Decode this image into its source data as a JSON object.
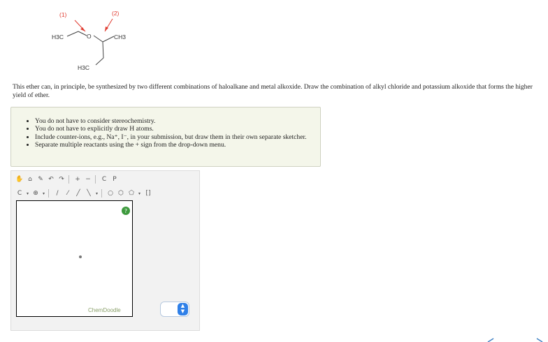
{
  "molecule": {
    "labels": {
      "left_methyl": "H3C",
      "oxygen": "O",
      "right_methyl": "CH3",
      "bottom_methyl": "H3C"
    },
    "arrow_labels": [
      "(1)",
      "(2)"
    ],
    "arrow_color": "#e03a2f"
  },
  "question": {
    "text": "This ether can, in principle, be synthesized by two different combinations of haloalkane and metal alkoxide. Draw the combination of alkyl chloride and potassium alkoxide that forms the higher yield of ether."
  },
  "notes": [
    "You do not have to consider stereochemistry.",
    "You do not have to explicitly draw H atoms.",
    "Include counter-ions, e.g., Na⁺, I⁻, in your submission, but draw them in their own separate sketcher.",
    "Separate multiple reactants using the + sign from the drop-down menu."
  ],
  "toolbar": {
    "row1": [
      {
        "name": "clear-icon",
        "glyph": "✋"
      },
      {
        "name": "erase-icon",
        "glyph": "⌂"
      },
      {
        "name": "pen-icon",
        "glyph": "✎"
      },
      {
        "name": "undo-icon",
        "glyph": "↶"
      },
      {
        "name": "redo-icon",
        "glyph": "↷"
      },
      {
        "name": "zoom-in-icon",
        "glyph": "+"
      },
      {
        "name": "zoom-out-icon",
        "glyph": "−"
      },
      {
        "name": "clean-icon",
        "glyph": "C"
      },
      {
        "name": "template-icon",
        "glyph": "P"
      }
    ],
    "row2": [
      {
        "name": "element-c-icon",
        "glyph": "C"
      },
      {
        "name": "charge-icon",
        "glyph": "⊕"
      },
      {
        "name": "single-bond-icon",
        "glyph": "/"
      },
      {
        "name": "double-bond-icon",
        "glyph": "⁄"
      },
      {
        "name": "wedge-bond-icon",
        "glyph": "╱"
      },
      {
        "name": "hash-bond-icon",
        "glyph": "╲"
      },
      {
        "name": "ring-icon",
        "glyph": "○"
      },
      {
        "name": "benzene-icon",
        "glyph": "⬡"
      },
      {
        "name": "pentagon-icon",
        "glyph": "⬠"
      },
      {
        "name": "bracket-icon",
        "glyph": "[]"
      }
    ]
  },
  "sketcher": {
    "brand": "ChemDoodle",
    "help_glyph": "?"
  },
  "reactant_select": {
    "value": "",
    "arrows": "▲▼"
  }
}
